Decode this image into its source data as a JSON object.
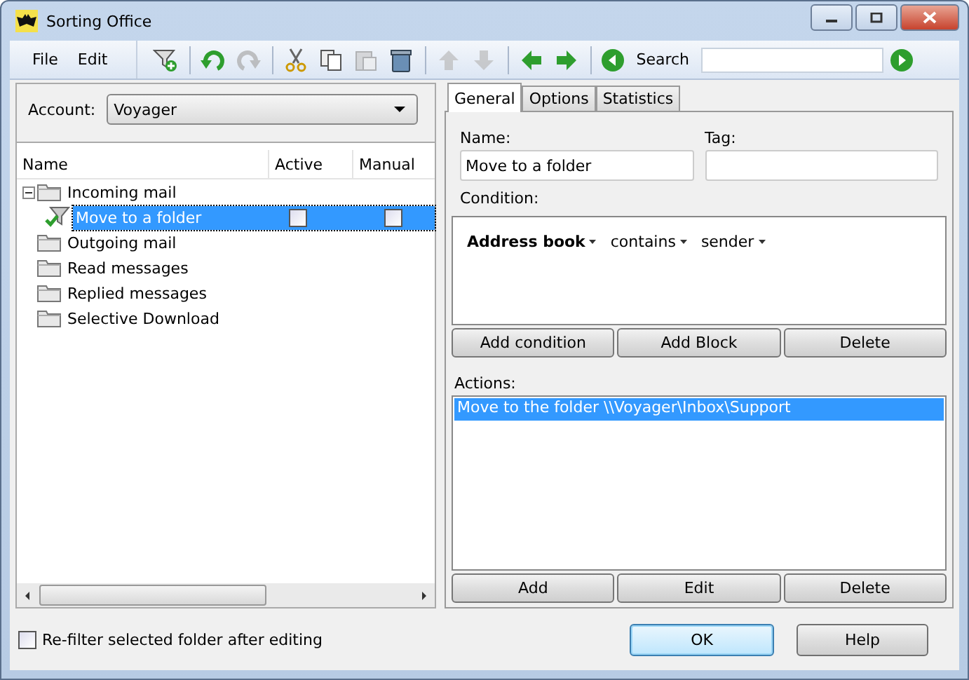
{
  "window": {
    "title": "Sorting Office"
  },
  "menu": [
    {
      "label": "File"
    },
    {
      "label": "Edit"
    }
  ],
  "toolbar": {
    "buttons": [
      {
        "kind": "add-filter",
        "disabled": false
      },
      {
        "kind": "undo",
        "disabled": false
      },
      {
        "kind": "redo",
        "disabled": true
      },
      {
        "kind": "cut",
        "disabled": false
      },
      {
        "kind": "copy",
        "disabled": false
      },
      {
        "kind": "paste",
        "disabled": true
      },
      {
        "kind": "delete",
        "disabled": false
      },
      {
        "kind": "up",
        "disabled": true
      },
      {
        "kind": "down",
        "disabled": true
      },
      {
        "kind": "left",
        "disabled": false
      },
      {
        "kind": "right",
        "disabled": false
      }
    ],
    "search_label": "Search"
  },
  "account": {
    "label": "Account:",
    "value": "Voyager"
  },
  "tree": {
    "columns": [
      "Name",
      "Active",
      "Manual"
    ],
    "items": [
      {
        "kind": "folder",
        "label": "Incoming mail",
        "selected": false,
        "expanded": true,
        "children": [
          {
            "kind": "filter",
            "label": "Move to a folder",
            "selected": true,
            "active": false,
            "manual": false
          }
        ]
      },
      {
        "kind": "folder",
        "label": "Outgoing mail",
        "selected": false
      },
      {
        "kind": "folder",
        "label": "Read messages",
        "selected": false
      },
      {
        "kind": "folder",
        "label": "Replied messages",
        "selected": false
      },
      {
        "kind": "folder",
        "label": "Selective Download",
        "selected": false
      }
    ]
  },
  "tabs": [
    {
      "label": "General",
      "selected": true
    },
    {
      "label": "Options",
      "selected": false
    },
    {
      "label": "Statistics",
      "selected": false
    }
  ],
  "general": {
    "name_label": "Name:",
    "name_value": "Move to a folder",
    "tag_label": "Tag:",
    "condition_label": "Condition:",
    "condition": [
      {
        "text": "Address book",
        "bold": true
      },
      {
        "text": "contains",
        "bold": false
      },
      {
        "text": "sender",
        "bold": false
      }
    ],
    "condition_buttons": [
      "Add condition",
      "Add Block",
      "Delete"
    ],
    "actions_label": "Actions:",
    "actions": [
      {
        "text": "Move to the folder \\\\Voyager\\Inbox\\Support",
        "selected": true
      }
    ],
    "action_buttons": [
      "Add",
      "Edit",
      "Delete"
    ]
  },
  "refilter": {
    "label": "Re-filter selected folder after editing",
    "checked": false
  },
  "dialog_buttons": [
    {
      "label": "OK",
      "default": true
    },
    {
      "label": "Help",
      "default": false
    }
  ]
}
